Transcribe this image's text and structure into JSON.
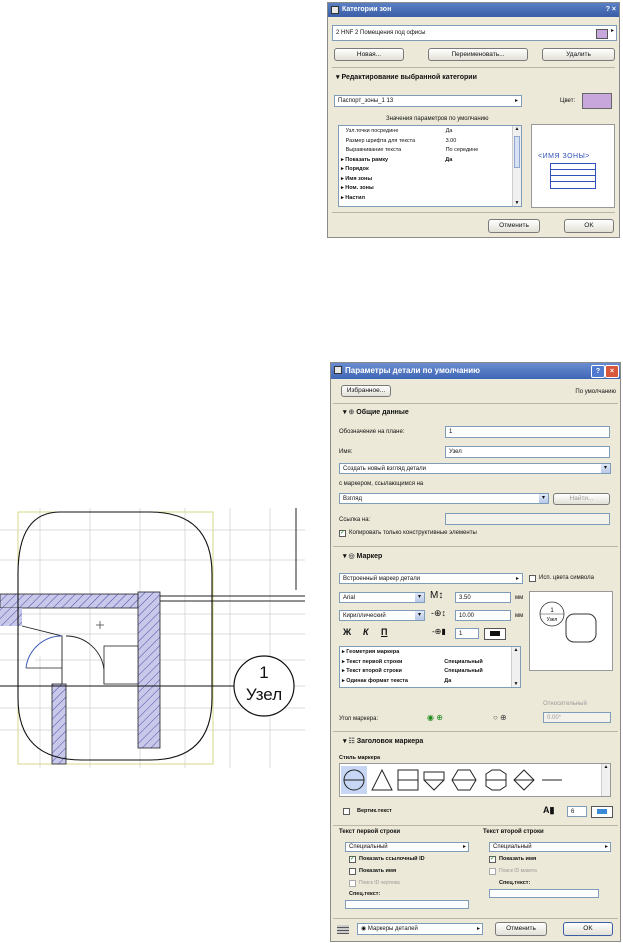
{
  "zone_dialog": {
    "title": "Категории зон",
    "help_close": "? ×",
    "category_value": "2 HNF  2 Помещения под офисы",
    "btn_new": "Новая...",
    "btn_rename": "Переименовать...",
    "btn_delete": "Удалить",
    "section_title": "Редактирование выбранной категории",
    "passport": "Паспорт_зоны_1 13",
    "color_label": "Цвет:",
    "color_value": "#c8a8dc",
    "defaults_label": "Значения параметров по умолчанию",
    "params": [
      {
        "name": "Узл.точки посредине",
        "value": "Да",
        "bold": false
      },
      {
        "name": "Размер шрифта для текста",
        "value": "3.00",
        "bold": false
      },
      {
        "name": "Выравнивание текста",
        "value": "По середине",
        "bold": false
      },
      {
        "name": "Показать рамку",
        "value": "Да",
        "bold": true
      },
      {
        "name": "Порядок",
        "value": "",
        "bold": true
      },
      {
        "name": "Имя зоны",
        "value": "",
        "bold": true
      },
      {
        "name": "Ном. зоны",
        "value": "",
        "bold": true
      },
      {
        "name": "Настил",
        "value": "",
        "bold": true
      }
    ],
    "preview_title": "<ИМЯ ЗОНЫ>",
    "btn_cancel": "Отменить",
    "btn_ok": "OK"
  },
  "detail_dialog": {
    "title": "Параметры детали по умолчанию",
    "favorites": "Избранное...",
    "default_label": "По умолчанию",
    "section_general": "Общие данные",
    "plan_label": "Обозначение на плане:",
    "plan_value": "1",
    "name_label": "Имя:",
    "name_value": "Узел",
    "create_view": "Создать новый взгляд детали",
    "marker_ref_label": "с маркером, ссылающимся на",
    "view_value": "Взгляд",
    "find_btn": "Найти...",
    "link_label": "Ссылка на:",
    "copy_check": "Копировать только конструктивные элементы",
    "section_marker": "Маркер",
    "marker_type": "Встроенный маркер детали",
    "use_symbol_colors": "Исп. цвета символа",
    "font": "Arial",
    "font_size": "3.50",
    "unit_mm": "мм",
    "charset": "Кириллический",
    "offset_value": "10.00",
    "style_b": "Ж",
    "style_i": "К",
    "style_u": "П",
    "pen_value": "1",
    "marker_params": [
      {
        "name": "Геометрия маркера",
        "value": ""
      },
      {
        "name": "Текст первой строки",
        "value": "Специальный"
      },
      {
        "name": "Текст второй строки",
        "value": "Специальный"
      },
      {
        "name": "Одинак формат текста",
        "value": "Да"
      }
    ],
    "relative_label": "Относительный",
    "angle_label": "Угол маркера:",
    "angle_value": "0.00°",
    "section_header": "Заголовок маркера",
    "marker_style_label": "Стиль маркера",
    "vertical_text": "Вертик.текст",
    "text_num": "6",
    "first_line_title": "Текст первой строки",
    "second_line_title": "Текст второй строки",
    "first_select": "Специальный",
    "second_select": "Специальный",
    "show_ref_id": "Показать ссылочный ID",
    "show_name_left": "Показать имя",
    "search_id": "Поиск ID чертежа",
    "spec_text_left": "Спец.текст:",
    "show_name_right": "Показать имя",
    "sheet_id": "Поиск ID макета",
    "spec_text_right": "Спец.текст:",
    "footer_select": "Маркеры деталей",
    "btn_cancel": "Отменить",
    "btn_ok": "OK"
  },
  "drawing": {
    "marker_number": "1",
    "marker_name": "Узел"
  }
}
